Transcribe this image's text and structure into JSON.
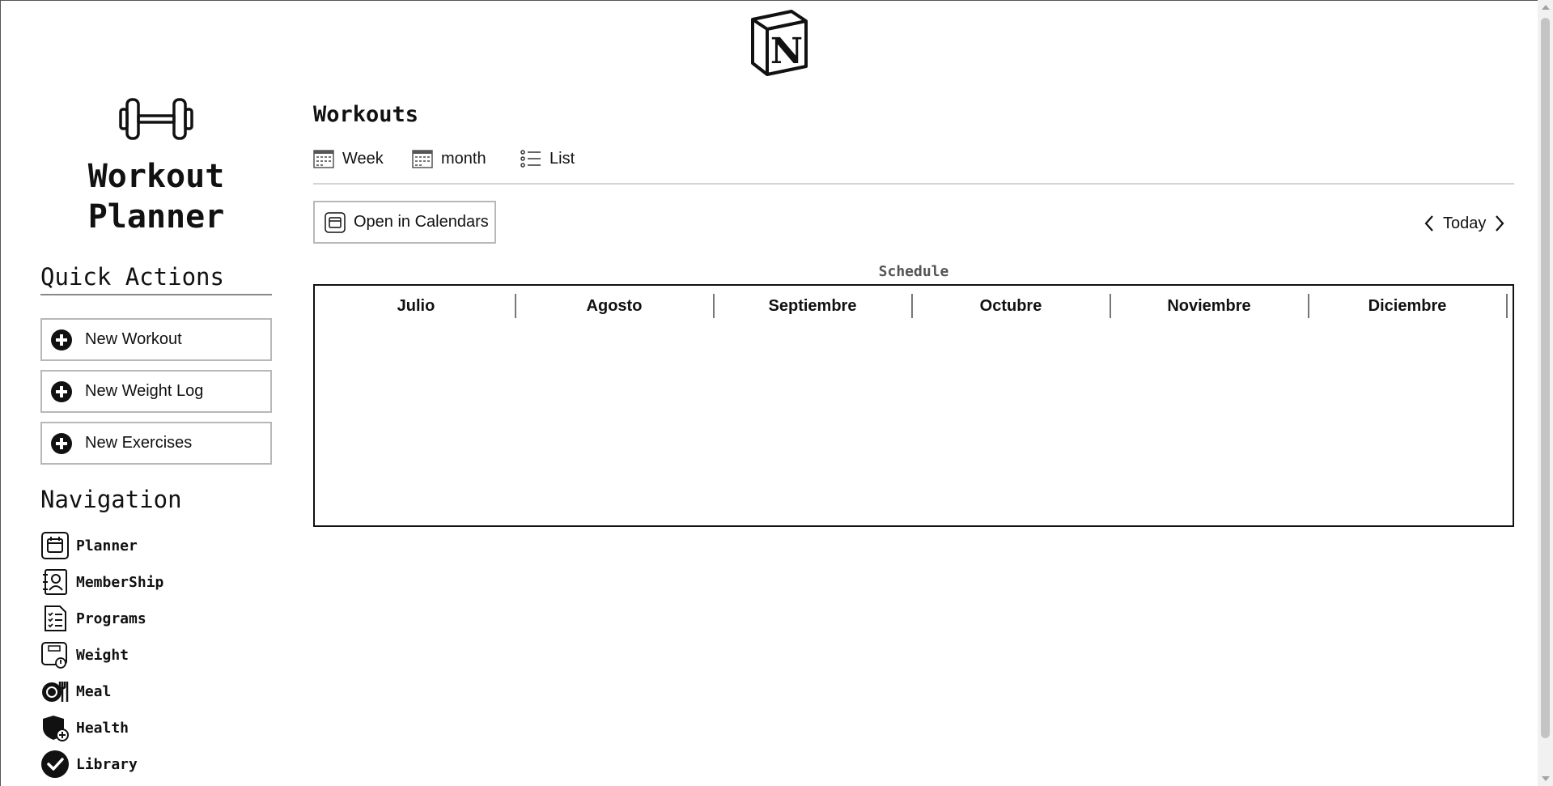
{
  "app": {
    "title": "Workout\nPlanner",
    "logo_icon": "notion-cube-logo",
    "hero_icon": "dumbbell-icon"
  },
  "quick_actions": {
    "heading": "Quick Actions",
    "items": [
      {
        "label": "New Workout",
        "icon": "plus-circle-icon"
      },
      {
        "label": "New Weight Log",
        "icon": "plus-circle-icon"
      },
      {
        "label": "New Exercises",
        "icon": "plus-circle-icon"
      }
    ]
  },
  "navigation": {
    "heading": "Navigation",
    "items": [
      {
        "label": "Planner",
        "icon": "calendar-icon"
      },
      {
        "label": "MemberShip",
        "icon": "contact-book-icon"
      },
      {
        "label": "Programs",
        "icon": "checklist-document-icon"
      },
      {
        "label": "Weight",
        "icon": "scale-icon"
      },
      {
        "label": "Meal",
        "icon": "plate-fork-icon"
      },
      {
        "label": "Health",
        "icon": "shield-plus-icon"
      },
      {
        "label": "Library",
        "icon": "check-circle-icon"
      }
    ]
  },
  "main": {
    "section_title": "Workouts",
    "views": [
      {
        "label": "Week",
        "icon": "calendar-grid-icon"
      },
      {
        "label": "month",
        "icon": "calendar-grid-icon"
      },
      {
        "label": "List",
        "icon": "bullet-list-icon"
      }
    ],
    "open_calendars_label": "Open in Calendars",
    "today_label": "Today",
    "schedule": {
      "label": "Schedule",
      "months": [
        "Julio",
        "Agosto",
        "Septiembre",
        "Octubre",
        "Noviembre",
        "Diciembre"
      ]
    }
  }
}
